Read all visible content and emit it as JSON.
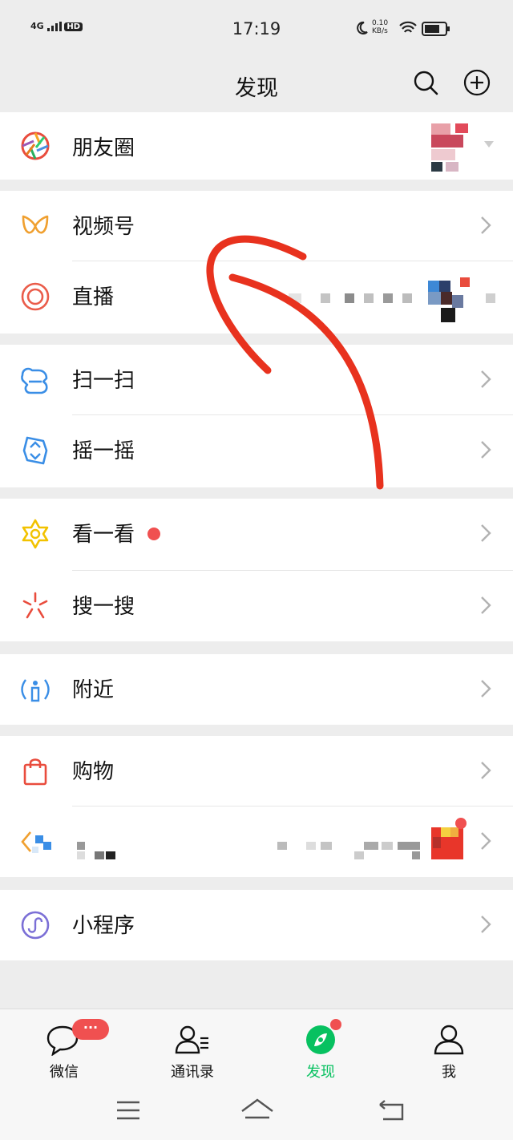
{
  "status": {
    "time": "17:19",
    "signal": "4G",
    "hd": "HD",
    "speed": "0.10 KB/s"
  },
  "header": {
    "title": "发现"
  },
  "rows": {
    "moments": "朋友圈",
    "channels": "视频号",
    "live": "直播",
    "scan": "扫一扫",
    "shake": "摇一摇",
    "top_stories": "看一看",
    "search": "搜一搜",
    "nearby": "附近",
    "shopping": "购物",
    "mini_programs": "小程序"
  },
  "tabs": {
    "chats": "微信",
    "chats_badge": "···",
    "contacts": "通讯录",
    "discover": "发现",
    "me": "我"
  },
  "colors": {
    "accent": "#07c160",
    "badge": "#f05050",
    "annotation": "#e8321e"
  }
}
